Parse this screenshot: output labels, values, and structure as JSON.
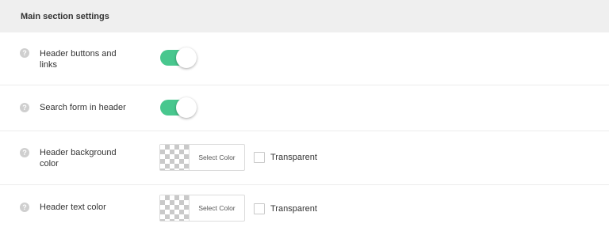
{
  "section": {
    "title": "Main section settings"
  },
  "help_glyph": "?",
  "colors": {
    "toggle_on": "#48c78e",
    "header_bg": "#efefef",
    "help_icon": "#cfcfcf"
  },
  "rows": [
    {
      "label": "Header buttons and links",
      "control": "toggle",
      "value": "on"
    },
    {
      "label": "Search form in header",
      "control": "toggle",
      "value": "on"
    },
    {
      "label": "Header background color",
      "control": "color",
      "button_label": "Select Color",
      "transparent_label": "Transparent",
      "transparent_checked": false
    },
    {
      "label": "Header text color",
      "control": "color",
      "button_label": "Select Color",
      "transparent_label": "Transparent",
      "transparent_checked": false
    }
  ]
}
